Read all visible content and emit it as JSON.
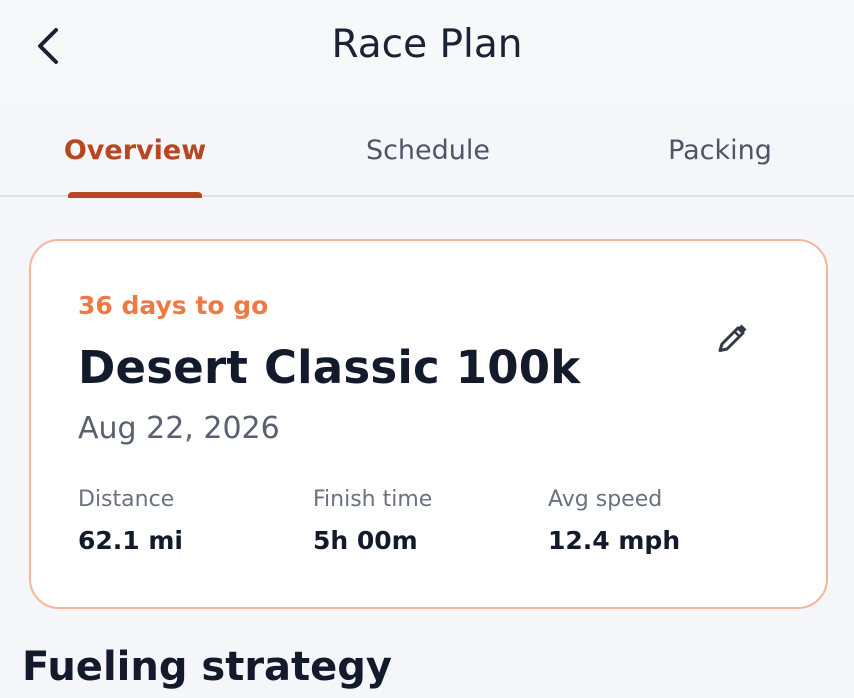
{
  "header": {
    "title": "Race Plan",
    "back_icon": "chevron-left-icon"
  },
  "tabs": [
    {
      "label": "Overview",
      "active": true
    },
    {
      "label": "Schedule",
      "active": false
    },
    {
      "label": "Packing",
      "active": false
    }
  ],
  "race_card": {
    "countdown": "36 days to go",
    "name": "Desert Classic 100k",
    "date": "Aug 22, 2026",
    "edit_icon": "pencil-icon",
    "stats": [
      {
        "label": "Distance",
        "value": "62.1 mi"
      },
      {
        "label": "Finish time",
        "value": "5h 00m"
      },
      {
        "label": "Avg speed",
        "value": "12.4 mph"
      }
    ]
  },
  "sections": {
    "fueling_title": "Fueling strategy"
  },
  "colors": {
    "accent": "#b8471f",
    "countdown": "#ec7a45",
    "card_border": "#f2b69c",
    "background": "#f5f6fa"
  }
}
